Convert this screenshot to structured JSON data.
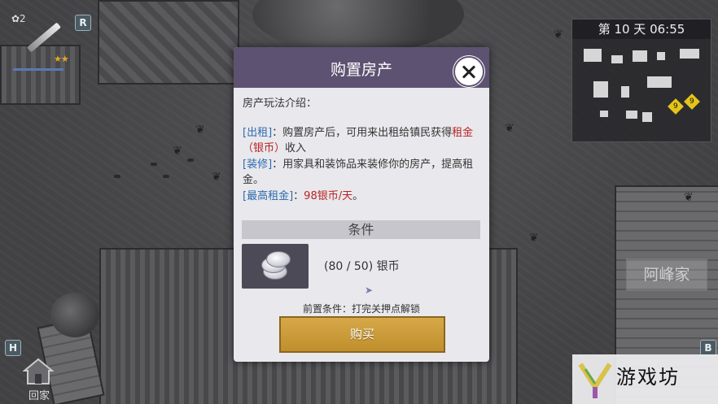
{
  "hud": {
    "weapon_count": "✿2",
    "weapon_stars": "★★",
    "key_r": "R",
    "key_h": "H",
    "key_b": "B"
  },
  "minimap": {
    "day_time": "第 10 天  06:55",
    "markers": [
      "9",
      "9"
    ]
  },
  "dialog": {
    "title": "购置房产",
    "intro": "房产玩法介绍：",
    "rent_tag": "[出租]",
    "rent_text_1": "：购置房产后，可用来出租给镇民获得",
    "rent_highlight": "租金（银币）",
    "rent_text_2": "收入",
    "decor_tag": "[装修]",
    "decor_text": "：用家具和装饰品来装修你的房产，提高租金。",
    "maxrent_tag": "[最高租金]",
    "maxrent_sep": "：",
    "maxrent_value": "98银币/天",
    "maxrent_end": "。",
    "conditions_header": "条件",
    "item_amount": "(80 / 50) 银币",
    "prerequisite": "前置条件：打完关押点解锁",
    "buy_label": "购买"
  },
  "world": {
    "house_label": "阿峰家",
    "home_label": "回家"
  },
  "watermark": {
    "text": "游戏坊"
  }
}
